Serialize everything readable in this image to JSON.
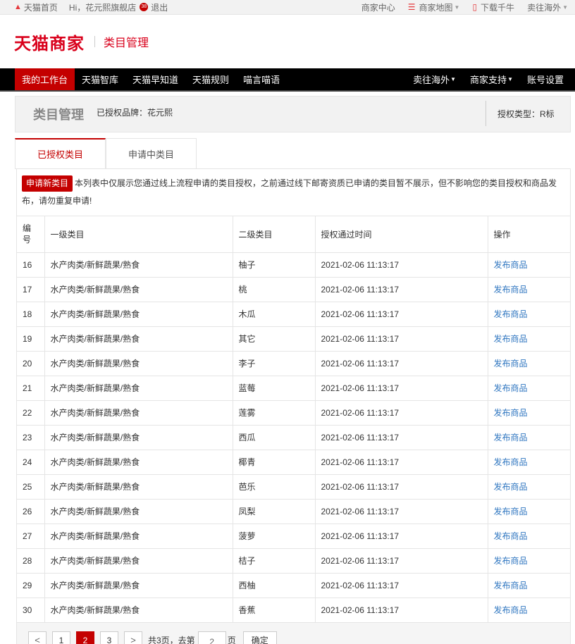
{
  "topbar": {
    "home": "天猫首页",
    "greeting": "Hi，花元熙旗舰店",
    "badge": "38",
    "logout": "退出",
    "seller_center": "商家中心",
    "site_map": "商家地图",
    "download": "下载千牛",
    "overseas": "卖往海外"
  },
  "header": {
    "logo": "天猫商家",
    "subtitle": "类目管理"
  },
  "nav": {
    "left": [
      "我的工作台",
      "天猫智库",
      "天猫早知道",
      "天猫规则",
      "喵言喵语"
    ],
    "right": [
      "卖往海外",
      "商家支持",
      "账号设置"
    ]
  },
  "titlebar": {
    "title": "类目管理",
    "brand": "已授权品牌：花元熙",
    "type": "授权类型：R标"
  },
  "tabs": [
    "已授权类目",
    "申请中类目"
  ],
  "notice": {
    "button": "申请新类目",
    "text": "本列表中仅展示您通过线上流程申请的类目授权，之前通过线下邮寄资质已申请的类目暂不展示，但不影响您的类目授权和商品发布，请勿重复申请!"
  },
  "table": {
    "headers": [
      "编号",
      "一级类目",
      "二级类目",
      "授权通过时间",
      "操作"
    ],
    "rows": [
      {
        "id": "16",
        "cat1": "水产肉类/新鲜蔬果/熟食",
        "cat2": "柚子",
        "time": "2021-02-06 11:13:17",
        "action": "发布商品"
      },
      {
        "id": "17",
        "cat1": "水产肉类/新鲜蔬果/熟食",
        "cat2": "桃",
        "time": "2021-02-06 11:13:17",
        "action": "发布商品"
      },
      {
        "id": "18",
        "cat1": "水产肉类/新鲜蔬果/熟食",
        "cat2": "木瓜",
        "time": "2021-02-06 11:13:17",
        "action": "发布商品"
      },
      {
        "id": "19",
        "cat1": "水产肉类/新鲜蔬果/熟食",
        "cat2": "其它",
        "time": "2021-02-06 11:13:17",
        "action": "发布商品"
      },
      {
        "id": "20",
        "cat1": "水产肉类/新鲜蔬果/熟食",
        "cat2": "李子",
        "time": "2021-02-06 11:13:17",
        "action": "发布商品"
      },
      {
        "id": "21",
        "cat1": "水产肉类/新鲜蔬果/熟食",
        "cat2": "蓝莓",
        "time": "2021-02-06 11:13:17",
        "action": "发布商品"
      },
      {
        "id": "22",
        "cat1": "水产肉类/新鲜蔬果/熟食",
        "cat2": "莲雾",
        "time": "2021-02-06 11:13:17",
        "action": "发布商品"
      },
      {
        "id": "23",
        "cat1": "水产肉类/新鲜蔬果/熟食",
        "cat2": "西瓜",
        "time": "2021-02-06 11:13:17",
        "action": "发布商品"
      },
      {
        "id": "24",
        "cat1": "水产肉类/新鲜蔬果/熟食",
        "cat2": "椰青",
        "time": "2021-02-06 11:13:17",
        "action": "发布商品"
      },
      {
        "id": "25",
        "cat1": "水产肉类/新鲜蔬果/熟食",
        "cat2": "芭乐",
        "time": "2021-02-06 11:13:17",
        "action": "发布商品"
      },
      {
        "id": "26",
        "cat1": "水产肉类/新鲜蔬果/熟食",
        "cat2": "凤梨",
        "time": "2021-02-06 11:13:17",
        "action": "发布商品"
      },
      {
        "id": "27",
        "cat1": "水产肉类/新鲜蔬果/熟食",
        "cat2": "菠萝",
        "time": "2021-02-06 11:13:17",
        "action": "发布商品"
      },
      {
        "id": "28",
        "cat1": "水产肉类/新鲜蔬果/熟食",
        "cat2": "桔子",
        "time": "2021-02-06 11:13:17",
        "action": "发布商品"
      },
      {
        "id": "29",
        "cat1": "水产肉类/新鲜蔬果/熟食",
        "cat2": "西柚",
        "time": "2021-02-06 11:13:17",
        "action": "发布商品"
      },
      {
        "id": "30",
        "cat1": "水产肉类/新鲜蔬果/熟食",
        "cat2": "香蕉",
        "time": "2021-02-06 11:13:17",
        "action": "发布商品"
      }
    ]
  },
  "pager": {
    "prev": "<",
    "pages": [
      "1",
      "2",
      "3"
    ],
    "current": "2",
    "next": ">",
    "total_text": "共3页，去第",
    "input_value": "2",
    "page_suffix": "页",
    "confirm": "确定"
  },
  "colors": {
    "brand_red": "#c40000",
    "link_blue": "#2f76c0",
    "nav_bg": "#000000"
  }
}
